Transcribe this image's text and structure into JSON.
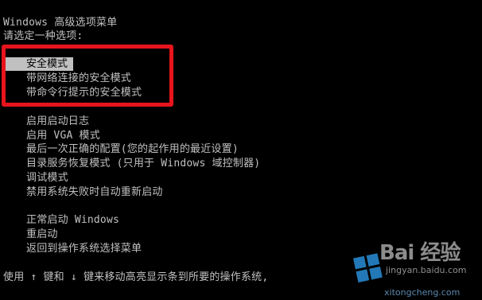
{
  "header": {
    "title": "Windows 高级选项菜单",
    "prompt": "请选定一种选项:"
  },
  "safe_group": {
    "selected": "安全模式",
    "items": [
      "带网络连接的安全模式",
      "带命令行提示的安全模式"
    ]
  },
  "boot_group": {
    "items": [
      "启用启动日志",
      "启用 VGA 模式",
      "最后一次正确的配置(您的起作用的最近设置)",
      "目录服务恢复模式 (只用于 Windows 域控制器)",
      "调试模式",
      "禁用系统失败时自动重新启动"
    ]
  },
  "start_group": {
    "items": [
      "正常启动 Windows",
      "重启动",
      "返回到操作系统选择菜单"
    ]
  },
  "footer": {
    "hint": "使用 ↑ 键和 ↓ 键来移动高亮显示条到所要的操作系统,"
  },
  "watermark": {
    "brand": "Bai 经验",
    "sub": "jingyan.baidu.com",
    "site": "xitongcheng.com"
  },
  "colors": {
    "background": "#000000",
    "text": "#c0c0c0",
    "highlight_bar": "#c0c0c0",
    "annotation_box": "#e8141c"
  }
}
